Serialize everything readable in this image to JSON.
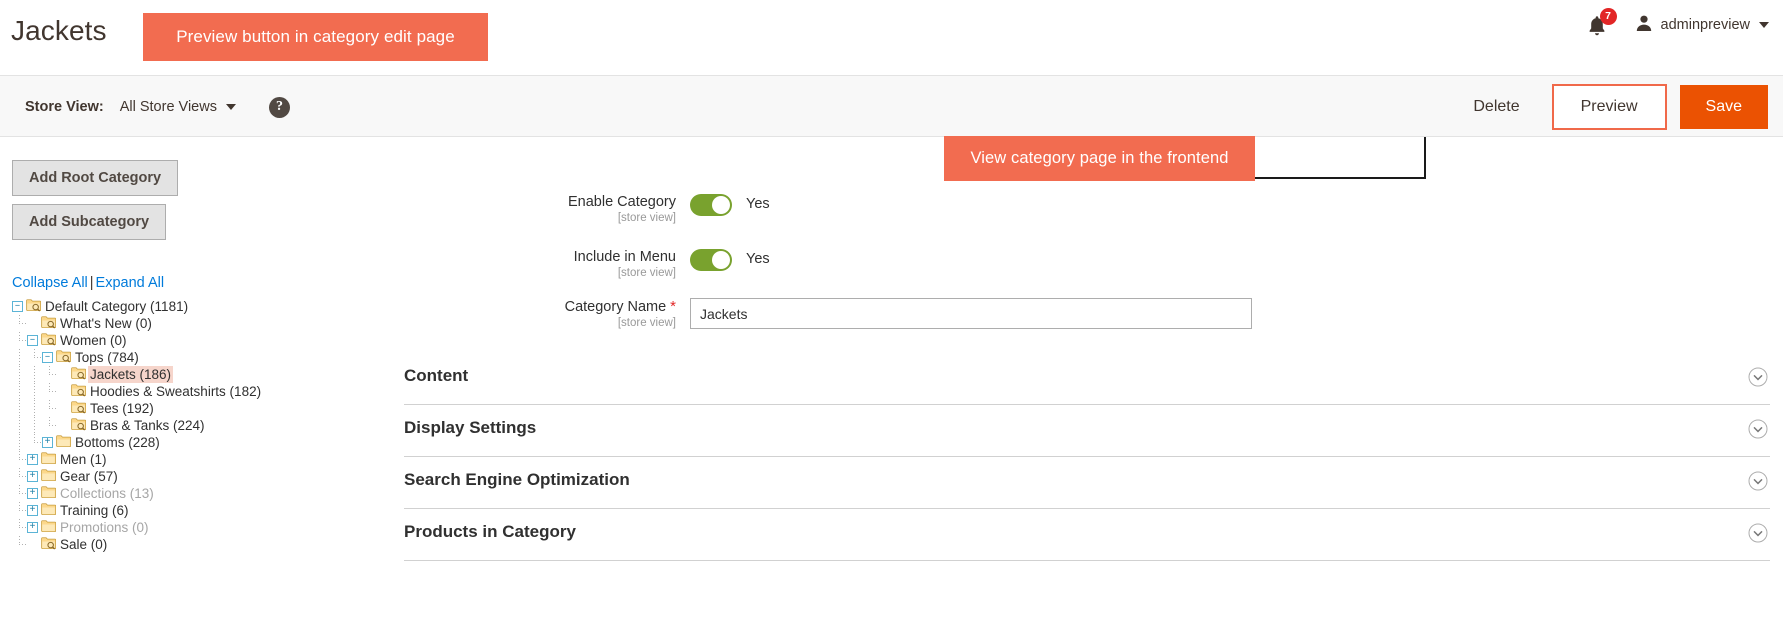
{
  "header": {
    "page_title": "Jackets",
    "annotation_1": "Preview button in category edit page",
    "notification_count": "7",
    "notification_icon": "bell-icon",
    "user_name": "adminpreview",
    "user_icon": "user-avatar-icon",
    "caret_icon": "chevron-down-icon"
  },
  "toolbar": {
    "store_view_label": "Store View:",
    "store_view_value": "All Store Views",
    "help_icon": "question-mark-icon",
    "delete_label": "Delete",
    "preview_label": "Preview",
    "save_label": "Save",
    "preview_highlight_color": "#f0694a",
    "save_color": "#eb5202"
  },
  "annotation_2": {
    "text": "View category page in the frontend",
    "background_color": "#f26c50",
    "connector_color": "#1a1a1a"
  },
  "sidebar": {
    "add_root_label": "Add Root Category",
    "add_sub_label": "Add Subcategory",
    "collapse_all": "Collapse All",
    "separator": "|",
    "expand_all": "Expand All",
    "tree": [
      {
        "label": "Default Category (1181)",
        "depth": 0,
        "toggle": "minus",
        "selected": false,
        "disabled": false,
        "folder_icon": "folder-search-icon"
      },
      {
        "label": "What's New (0)",
        "depth": 1,
        "toggle": "none",
        "selected": false,
        "disabled": false,
        "folder_icon": "folder-search-icon"
      },
      {
        "label": "Women (0)",
        "depth": 1,
        "toggle": "minus",
        "selected": false,
        "disabled": false,
        "folder_icon": "folder-search-icon"
      },
      {
        "label": "Tops (784)",
        "depth": 2,
        "toggle": "minus",
        "selected": false,
        "disabled": false,
        "folder_icon": "folder-search-icon"
      },
      {
        "label": "Jackets (186)",
        "depth": 3,
        "toggle": "none",
        "selected": true,
        "disabled": false,
        "folder_icon": "folder-search-icon"
      },
      {
        "label": "Hoodies & Sweatshirts (182)",
        "depth": 3,
        "toggle": "none",
        "selected": false,
        "disabled": false,
        "folder_icon": "folder-search-icon"
      },
      {
        "label": "Tees (192)",
        "depth": 3,
        "toggle": "none",
        "selected": false,
        "disabled": false,
        "folder_icon": "folder-search-icon"
      },
      {
        "label": "Bras & Tanks (224)",
        "depth": 3,
        "toggle": "none",
        "selected": false,
        "disabled": false,
        "folder_icon": "folder-search-icon"
      },
      {
        "label": "Bottoms (228)",
        "depth": 2,
        "toggle": "plus",
        "selected": false,
        "disabled": false,
        "folder_icon": "folder-icon"
      },
      {
        "label": "Men (1)",
        "depth": 1,
        "toggle": "plus",
        "selected": false,
        "disabled": false,
        "folder_icon": "folder-icon"
      },
      {
        "label": "Gear (57)",
        "depth": 1,
        "toggle": "plus",
        "selected": false,
        "disabled": false,
        "folder_icon": "folder-icon"
      },
      {
        "label": "Collections (13)",
        "depth": 1,
        "toggle": "plus",
        "selected": false,
        "disabled": true,
        "folder_icon": "folder-icon"
      },
      {
        "label": "Training (6)",
        "depth": 1,
        "toggle": "plus",
        "selected": false,
        "disabled": false,
        "folder_icon": "folder-icon"
      },
      {
        "label": "Promotions (0)",
        "depth": 1,
        "toggle": "plus",
        "selected": false,
        "disabled": true,
        "folder_icon": "folder-icon"
      },
      {
        "label": "Sale (0)",
        "depth": 1,
        "toggle": "none",
        "selected": false,
        "disabled": false,
        "folder_icon": "folder-search-icon"
      }
    ]
  },
  "form": {
    "scope_note": "[store view]",
    "enable_category": {
      "label": "Enable Category",
      "value_text": "Yes",
      "state": "on"
    },
    "include_in_menu": {
      "label": "Include in Menu",
      "value_text": "Yes",
      "state": "on"
    },
    "category_name": {
      "label": "Category Name",
      "required_marker": "*",
      "value": "Jackets",
      "placeholder": ""
    },
    "toggle_on_color": "#79a22e"
  },
  "accordion": {
    "chevron_icon": "chevron-down-circle-icon",
    "sections": [
      {
        "title": "Content"
      },
      {
        "title": "Display Settings"
      },
      {
        "title": "Search Engine Optimization"
      },
      {
        "title": "Products in Category"
      }
    ]
  }
}
